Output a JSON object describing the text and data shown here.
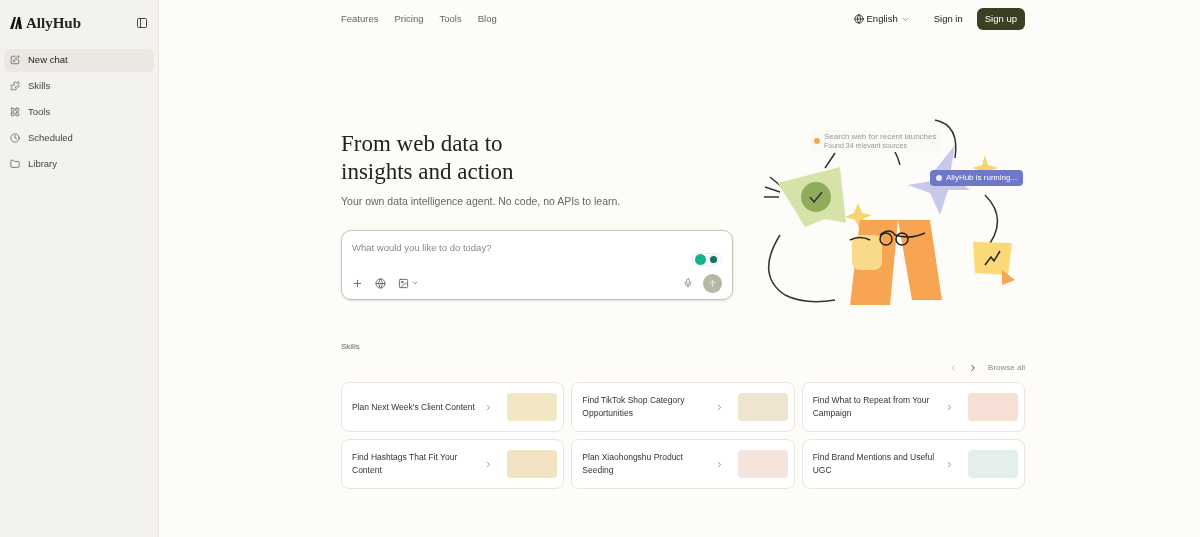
{
  "sidebar": {
    "logo": "AllyHub",
    "items": [
      {
        "label": "New chat",
        "selected": true
      },
      {
        "label": "Skills",
        "selected": false
      },
      {
        "label": "Tools",
        "selected": false
      },
      {
        "label": "Scheduled",
        "selected": false
      },
      {
        "label": "Library",
        "selected": false
      }
    ]
  },
  "header": {
    "links": [
      "Features",
      "Pricing",
      "Tools",
      "Blog"
    ],
    "language": "English",
    "sign_in": "Sign in",
    "sign_up": "Sign up"
  },
  "hero": {
    "title_lines": [
      "From web data to",
      "insights and action"
    ],
    "subtitle": "Your own data intelligence agent. No code, no APIs to learn."
  },
  "prompt": {
    "placeholder": "What would you like to do today?"
  },
  "illustration": {
    "search_card": {
      "title": "Search web for recent launches",
      "subtitle": "Found 34 relevant sources"
    },
    "status_chip": "AllyHub is running..."
  },
  "skills": {
    "heading": "Skills",
    "browse_all": "Browse all",
    "prev_disabled": true,
    "next_disabled": false,
    "cards": [
      {
        "title": "Plan Next Week's Client Content"
      },
      {
        "title": "Find TikTok Shop Category Opportunities"
      },
      {
        "title": "Find What to Repeat from Your Campaign"
      },
      {
        "title": "Find Hashtags That Fit Your Content"
      },
      {
        "title": "Plan Xiaohongshu Product Seeding"
      },
      {
        "title": "Find Brand Mentions and Useful UGC"
      }
    ]
  }
}
